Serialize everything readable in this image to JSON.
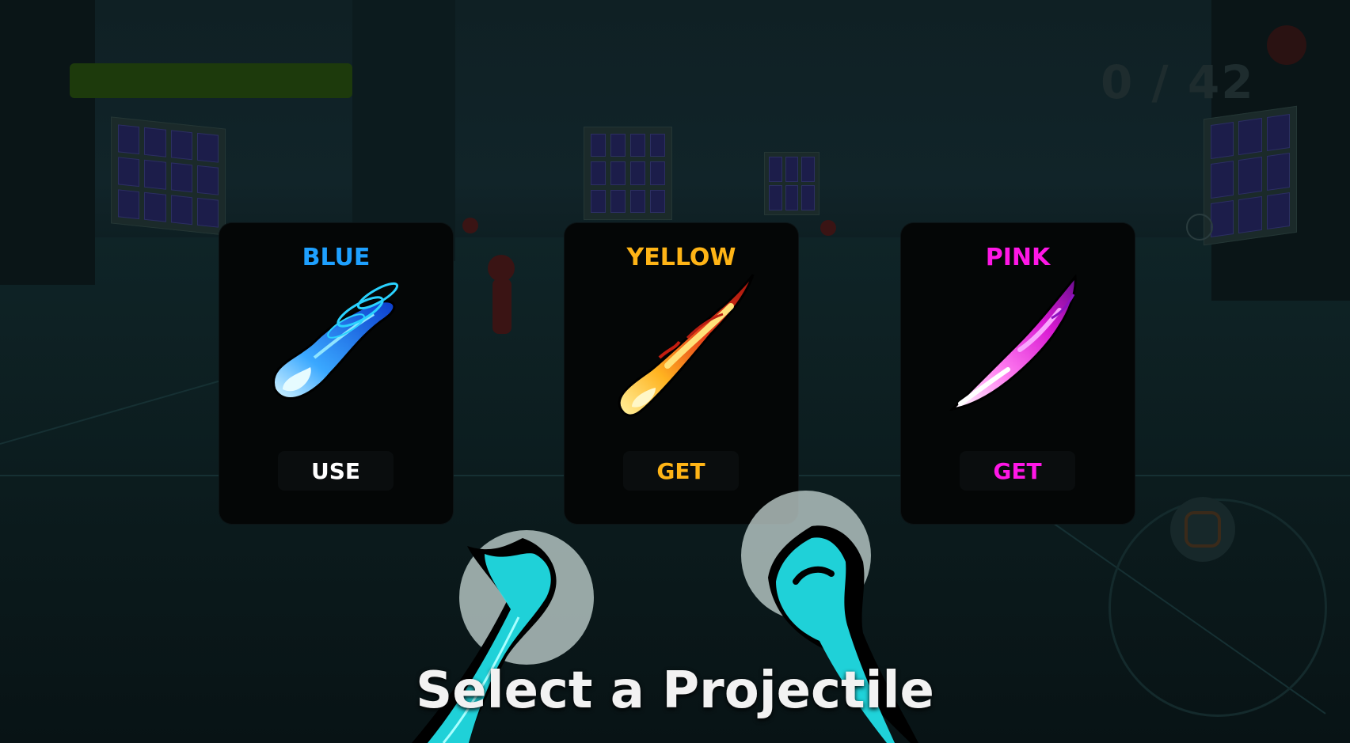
{
  "hud": {
    "counter": "0 / 42"
  },
  "cards": [
    {
      "title": "BLUE",
      "action": "USE",
      "color": "#1ea0ff",
      "action_color": "#ffffff",
      "icon": "blue-projectile-icon"
    },
    {
      "title": "YELLOW",
      "action": "GET",
      "color": "#ffb416",
      "action_color": "#ffb416",
      "icon": "fire-projectile-icon"
    },
    {
      "title": "PINK",
      "action": "GET",
      "color": "#ff17e6",
      "action_color": "#ff17e6",
      "icon": "pink-projectile-icon"
    }
  ],
  "prompt": "Select a Projectile",
  "colors": {
    "hand_glow": "#22e8f0",
    "health_bar": "#1d3a0c"
  }
}
